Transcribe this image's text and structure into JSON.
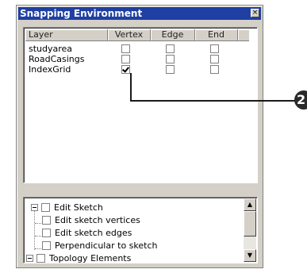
{
  "window": {
    "title": "Snapping Environment",
    "close_glyph": "×"
  },
  "layers_table": {
    "columns": [
      "Layer",
      "Vertex",
      "Edge",
      "End"
    ],
    "rows": [
      {
        "name": "studyarea",
        "vertex": false,
        "edge": false,
        "end": false
      },
      {
        "name": "RoadCasings",
        "vertex": false,
        "edge": false,
        "end": false
      },
      {
        "name": "IndexGrid",
        "vertex": true,
        "edge": false,
        "end": false
      }
    ]
  },
  "tree": {
    "items": [
      {
        "label": "Edit Sketch",
        "checked": false,
        "expanded": true
      },
      {
        "label": "Edit sketch vertices",
        "checked": false
      },
      {
        "label": "Edit sketch edges",
        "checked": false
      },
      {
        "label": "Perpendicular to sketch",
        "checked": false
      },
      {
        "label": "Topology Elements",
        "checked": false,
        "expanded": true
      }
    ]
  },
  "scrollbar": {
    "up_glyph": "▲",
    "down_glyph": "▼"
  },
  "callout": {
    "number": "2"
  }
}
